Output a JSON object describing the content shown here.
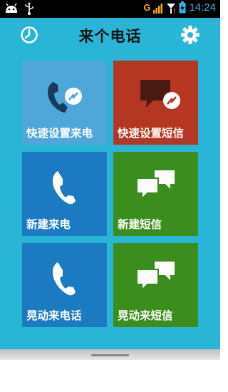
{
  "status_bar": {
    "network": "G",
    "time": "14:24"
  },
  "header": {
    "title": "来个电话"
  },
  "tiles": [
    {
      "label": "快速设置来电",
      "icon": "quick-call-icon",
      "color": "#4fa6d9"
    },
    {
      "label": "快速设置短信",
      "icon": "quick-sms-icon",
      "color": "#b53722"
    },
    {
      "label": "新建来电",
      "icon": "phone-icon",
      "color": "#1b7ac2"
    },
    {
      "label": "新建短信",
      "icon": "chat-bubbles-icon",
      "color": "#3b8d1d"
    },
    {
      "label": "晃动来电话",
      "icon": "phone-icon",
      "color": "#1b7ac2"
    },
    {
      "label": "晃动来短信",
      "icon": "chat-bubbles-icon",
      "color": "#3b8d1d"
    }
  ],
  "colors": {
    "app_background": "#29b6d6",
    "time_accent": "#33b5e5"
  }
}
